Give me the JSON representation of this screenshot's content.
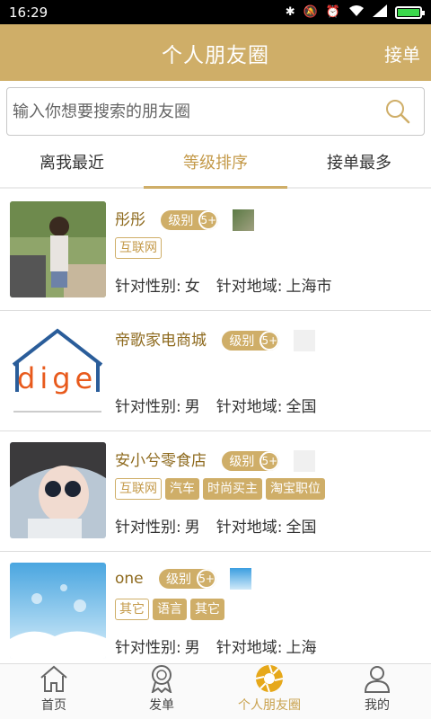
{
  "status_bar": {
    "time": "16:29",
    "icons": [
      "bluetooth-icon",
      "mute-icon",
      "alarm-icon",
      "wifi-icon",
      "signal-icon",
      "battery-icon"
    ],
    "battery_level": 1.0
  },
  "header": {
    "title": "个人朋友圈",
    "action_label": "接单",
    "bg_color": "#cfae68"
  },
  "search": {
    "placeholder": "输入你想要搜索的朋友圈",
    "value": ""
  },
  "tabs": [
    {
      "label": "离我最近",
      "active": false
    },
    {
      "label": "等级排序",
      "active": true
    },
    {
      "label": "接单最多",
      "active": false
    }
  ],
  "items": [
    {
      "name": "彤彤",
      "level_label": "级别",
      "level_num": "5+",
      "tags": [
        {
          "text": "互联网",
          "style": "outline"
        }
      ],
      "gender_label": "针对性别:",
      "gender": "女",
      "region_label": "针对地域:",
      "region": "上海市"
    },
    {
      "name": "帝歌家电商城",
      "level_label": "级别",
      "level_num": "5+",
      "logo_text": "dige",
      "tags": [],
      "gender_label": "针对性别:",
      "gender": "男",
      "region_label": "针对地域:",
      "region": "全国"
    },
    {
      "name": "安小兮零食店",
      "level_label": "级别",
      "level_num": "5+",
      "tags": [
        {
          "text": "互联网",
          "style": "outline"
        },
        {
          "text": "汽车",
          "style": "filled"
        },
        {
          "text": "时尚买主",
          "style": "filled"
        },
        {
          "text": "淘宝职位",
          "style": "filled"
        }
      ],
      "gender_label": "针对性别:",
      "gender": "男",
      "region_label": "针对地域:",
      "region": "全国"
    },
    {
      "name": "one",
      "level_label": "级别",
      "level_num": "5+",
      "tags": [
        {
          "text": "其它",
          "style": "outline"
        },
        {
          "text": "语言",
          "style": "filled"
        },
        {
          "text": "其它",
          "style": "filled"
        }
      ],
      "gender_label": "针对性别:",
      "gender": "男",
      "region_label": "针对地域:",
      "region": "上海"
    }
  ],
  "bottom_nav": [
    {
      "label": "首页",
      "icon": "home-icon",
      "active": false
    },
    {
      "label": "发单",
      "icon": "medal-icon",
      "active": false
    },
    {
      "label": "个人朋友圈",
      "icon": "aperture-icon",
      "active": true
    },
    {
      "label": "我的",
      "icon": "user-icon",
      "active": false
    }
  ]
}
